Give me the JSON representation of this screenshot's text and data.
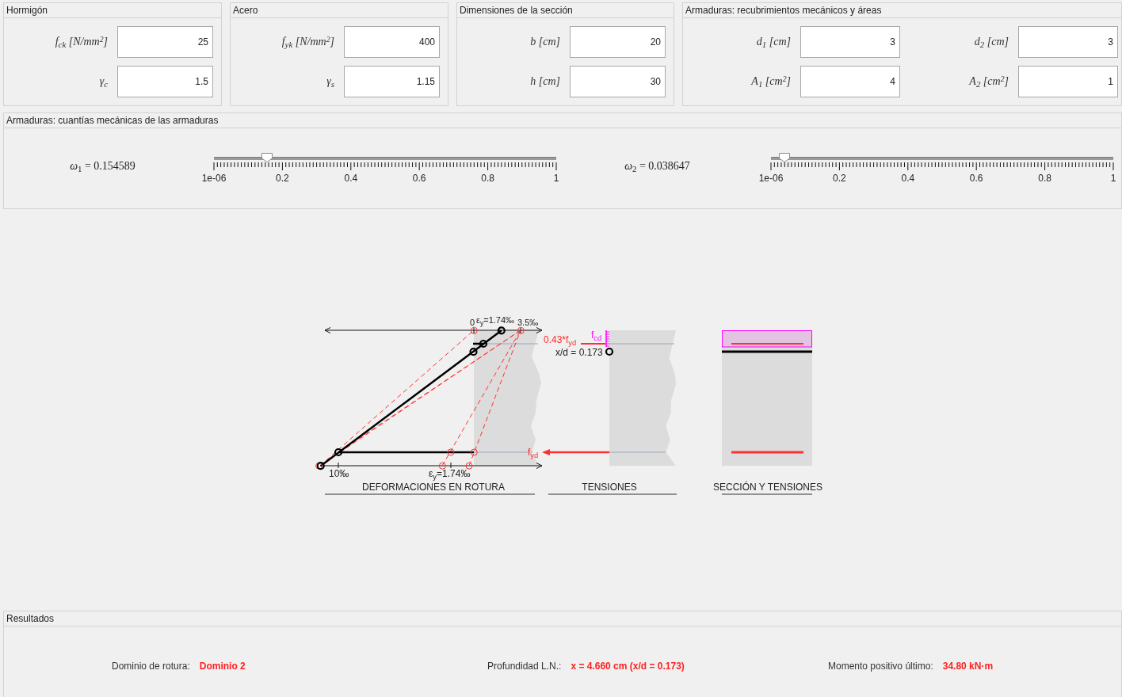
{
  "input_panels": [
    {
      "title": "Hormigón",
      "fields": [
        {
          "label": "f$_{ck}$ [N/mm$^{2}$]",
          "value": "25"
        },
        {
          "label": "γ$_{c}$",
          "value": "1.5"
        }
      ]
    },
    {
      "title": "Acero",
      "fields": [
        {
          "label": "f$_{yk}$ [N/mm$^{2}$]",
          "value": "400"
        },
        {
          "label": "γ$_{s}$",
          "value": "1.15"
        }
      ]
    },
    {
      "title": "Dimensiones de la sección",
      "fields": [
        {
          "label": "b [cm]",
          "value": "20"
        },
        {
          "label": "h [cm]",
          "value": "30"
        }
      ]
    },
    {
      "title": "Armaduras: recubrimientos mecánicos y áreas",
      "fields": [
        {
          "label": "d$_{1}$ [cm]",
          "value": "3"
        },
        {
          "label": "d$_{2}$ [cm]",
          "value": "3"
        },
        {
          "label": "A$_{1}$ [cm$^{2}$]",
          "value": "4"
        },
        {
          "label": "A$_{2}$ [cm$^{2}$]",
          "value": "1"
        }
      ]
    }
  ],
  "ratios": {
    "title": "Armaduras: cuantías mecánicas de las armaduras",
    "sliders": [
      {
        "label": "*ω*$_{1}$ = 0.154589",
        "level": 0.154589,
        "ticks": [
          "1e-06",
          "0.2",
          "0.4",
          "0.6",
          "0.8",
          "1"
        ]
      },
      {
        "label": "*ω*$_{2}$ = 0.038647",
        "level": 0.038647,
        "ticks": [
          "1e-06",
          "0.2",
          "0.4",
          "0.6",
          "0.8",
          "1"
        ]
      }
    ]
  },
  "diagram": {
    "deformations": {
      "caption": "DEFORMACIONES EN ROTURA",
      "labels": [
        {
          "kind": "zero",
          "text": "0"
        },
        {
          "kind": "yield",
          "text": "ε$_{y}$=1.74‰"
        },
        {
          "kind": "crush",
          "text": "3.5‰"
        },
        {
          "kind": "tension_limit",
          "text": "10‰"
        },
        {
          "kind": "negative_yield",
          "text": "ε$_{y}$=1.74‰"
        }
      ]
    },
    "stresses": {
      "caption": "TENSIONES",
      "labels": [
        {
          "kind": "compression_steel",
          "text": "0.43*f$_{yd}$"
        },
        {
          "kind": "concrete",
          "text": "f$_{cd}$"
        },
        {
          "kind": "depth",
          "text": "x/d = 0.173"
        },
        {
          "kind": "tension_steel",
          "text": "f$_{yd}$"
        }
      ]
    },
    "section": {
      "caption": "SECCIÓN Y TENSIONES"
    }
  },
  "results": {
    "title": "Resultados",
    "items": [
      {
        "label": "Dominio de rotura:",
        "value": "Dominio 2"
      },
      {
        "label": "Profundidad L.N.:",
        "value": "x = 4.660 cm (x/d = 0.173)"
      },
      {
        "label": "Momento positivo último:",
        "value": "34.80 kN·m"
      }
    ]
  }
}
